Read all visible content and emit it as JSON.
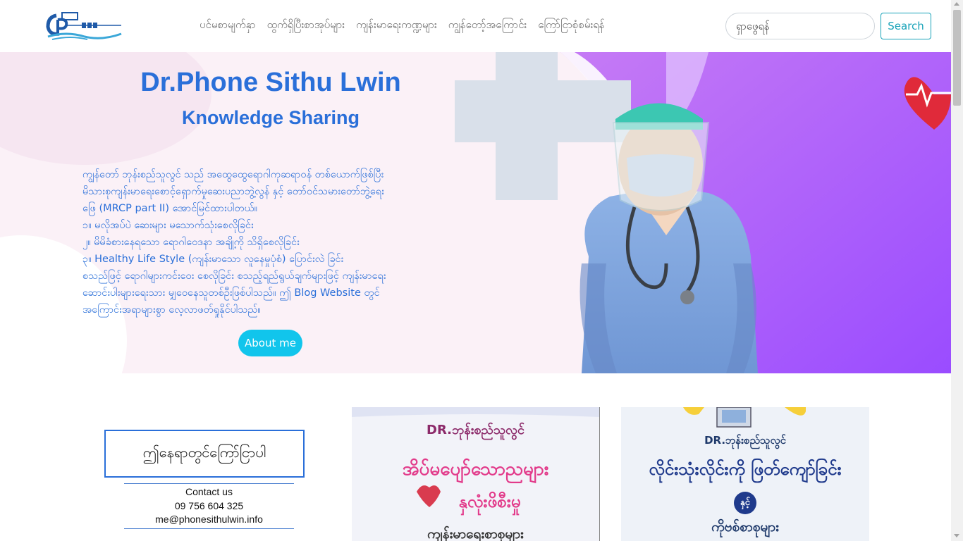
{
  "navbar": {
    "logo_alt": "Dr.Phone Sithu Lwin logo",
    "links": [
      "ပင်မစာမျက်နှာ",
      "ထွက်ရှိပြီးစာအုပ်များ",
      "ကျန်းမာရေးကဏ္ဍများ",
      "ကျွန်တော့်အကြောင်း",
      "ကြော်ငြာစုံစမ်းရန်"
    ],
    "search_placeholder": "ရှာဖွေရန်",
    "search_label": "Search"
  },
  "hero": {
    "title": "Dr.Phone Sithu Lwin",
    "subtitle": "Knowledge Sharing",
    "paragraph_lines": [
      "ကျွန်တော် ဘုန်းစည်သူလွင် သည် အထွေထွေရောဂါကုဆရာဝန် တစ်ယောက်ဖြစ်ပြီး",
      "မိသားစုကျန်းမာရေးစောင့်ရှောက်မှုဆေးပညာဘွဲ့လွန် နှင့် တော်ဝင်သမားတော်ဘွဲ့ရေး",
      "ဖြေ (MRCP part II) အောင်မြင်ထားပါတယ်။",
      "၁။ မလိုအပ်ပဲ ဆေးများ မသောက်သုံးစေလိုခြင်း",
      "၂။ မိမိခံစားနေရသော ရောဂါဝေဒနာ အချို့ကို သိရှိစေလိုခြင်း",
      "၃။ Healthy Life Style (ကျန်းမာသော လူနေမှုပုံစံ) ပြောင်းလဲ ခြင်း",
      "စသည်ဖြင့် ရောဂါများကင်းဝေး စေလိုခြင်း စသည့်ရည်ရွယ်ချက်များဖြင့် ကျန်းမာရေး",
      "ဆောင်းပါးများရေးသား မျှဝေနေသူတစ်ဦးဖြစ်ပါသည်။ ဤ Blog Website တွင်",
      "အကြောင်းအရာများစွာ လေ့လာဖတ်ရှုနိုင်ပါသည်။"
    ],
    "about_label": "About me"
  },
  "contact": {
    "heading": "ဤနေရာတွင်ကြော်ငြာပါ",
    "label": "Contact us",
    "phone": "09 756 604 325",
    "email": "me@phonesithulwin.info"
  },
  "books": [
    {
      "author": "DR.ဘုန်းစည်သူလွင်",
      "title_line1": "အိပ်မပျော်သောညများ",
      "title_line2": "နှလုံးဖိစီးမှု",
      "bottom": "ကျန်းမာရေးစာစုများ"
    },
    {
      "author": "DR.ဘုန်းစည်သူလွင်",
      "title_line1": "လိုင်းသုံးလိုင်းကို ဖြတ်ကျော်ခြင်း",
      "conjunction": "နှင့်",
      "bottom": "ကိုဗစ်စာစုများ"
    }
  ],
  "colors": {
    "brand_blue": "#2a6fd9",
    "button_cyan": "#11c5ec",
    "search_teal": "#17a2b8",
    "hero_purple": "#a55bff"
  }
}
